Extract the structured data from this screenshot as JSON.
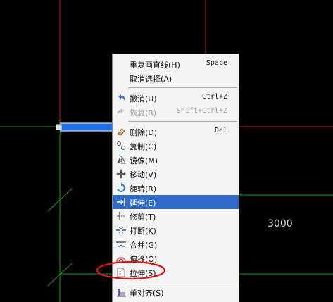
{
  "canvas": {
    "dimension_text": "3000"
  },
  "menu": {
    "group1": [
      {
        "label": "重复画直线(H)",
        "shortcut": "Space"
      },
      {
        "label": "取消选择(A)",
        "shortcut": ""
      }
    ],
    "group2": [
      {
        "label": "撤消(U)",
        "shortcut": "Ctrl+Z",
        "icon": "undo-icon"
      },
      {
        "label": "恢复(R)",
        "shortcut": "Shift+Ctrl+Z",
        "icon": "redo-icon",
        "disabled": true
      }
    ],
    "group3": [
      {
        "label": "删除(D)",
        "shortcut": "Del",
        "icon": "eraser-icon"
      },
      {
        "label": "复制(C)",
        "shortcut": "",
        "icon": "copy-icon"
      },
      {
        "label": "镜像(M)",
        "shortcut": "",
        "icon": "mirror-icon"
      },
      {
        "label": "移动(V)",
        "shortcut": "",
        "icon": "move-icon"
      },
      {
        "label": "旋转(R)",
        "shortcut": "",
        "icon": "rotate-icon"
      },
      {
        "label": "延伸(E)",
        "shortcut": "",
        "icon": "extend-icon",
        "highlighted": true
      },
      {
        "label": "修剪(T)",
        "shortcut": "",
        "icon": "trim-icon"
      },
      {
        "label": "打断(K)",
        "shortcut": "",
        "icon": "break-icon"
      },
      {
        "label": "合并(G)",
        "shortcut": "",
        "icon": "join-icon"
      },
      {
        "label": "偏移(O)",
        "shortcut": "",
        "icon": "offset-icon"
      },
      {
        "label": "拉伸(S)",
        "shortcut": "",
        "icon": "stretch-icon"
      }
    ],
    "group4": [
      {
        "label": "单对齐(S)",
        "shortcut": "",
        "icon": "align-icon"
      }
    ]
  },
  "colors": {
    "highlight": "#316ac5",
    "grid_red": "#c81e1e",
    "grid_green": "#1e9a1e",
    "wall_blue": "#1e6ee6",
    "annotation_red": "#e01010"
  }
}
